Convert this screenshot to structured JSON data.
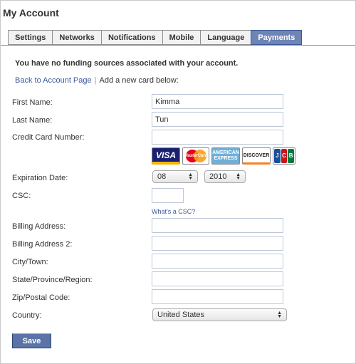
{
  "page": {
    "title": "My Account"
  },
  "tabs": [
    "Settings",
    "Networks",
    "Notifications",
    "Mobile",
    "Language",
    "Payments"
  ],
  "notice": "You have no funding sources associated with your account.",
  "links": {
    "back": "Back to Account Page",
    "separator": "|",
    "add_card": "Add a new card below:"
  },
  "form": {
    "first_name": {
      "label": "First Name:",
      "value": "Kimma"
    },
    "last_name": {
      "label": "Last Name:",
      "value": "Tun"
    },
    "card_number": {
      "label": "Credit Card Number:",
      "value": ""
    },
    "card_brands": [
      "VISA",
      "MasterCard",
      "AMERICAN EXPRESS",
      "DISCOVER",
      "JCB"
    ],
    "expiration": {
      "label": "Expiration Date:",
      "month": "08",
      "year": "2010"
    },
    "csc": {
      "label": "CSC:",
      "value": "",
      "help": "What's a CSC?"
    },
    "billing_address": {
      "label": "Billing Address:",
      "value": ""
    },
    "billing_address_2": {
      "label": "Billing Address 2:",
      "value": ""
    },
    "city": {
      "label": "City/Town:",
      "value": ""
    },
    "state": {
      "label": "State/Province/Region:",
      "value": ""
    },
    "zip": {
      "label": "Zip/Postal Code:",
      "value": ""
    },
    "country": {
      "label": "Country:",
      "value": "United States"
    }
  },
  "save_label": "Save",
  "colors": {
    "accent": "#3b5998",
    "active_tab": "#6d84b4",
    "save_button": "#5b74a8"
  }
}
